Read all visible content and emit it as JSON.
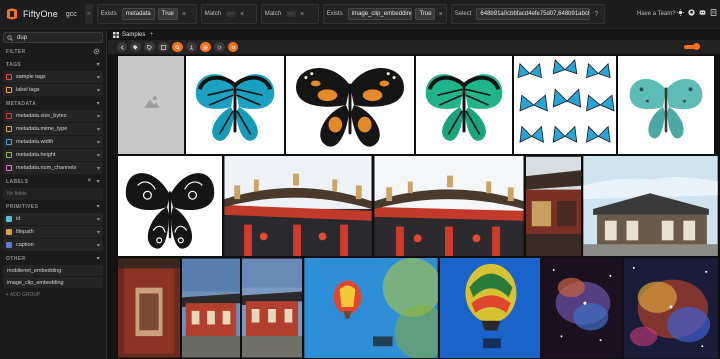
{
  "header": {
    "brand": "FiftyOne",
    "dataset": "gcc",
    "stages": [
      {
        "field": "metadata",
        "value": "True",
        "name": "Exists"
      },
      {
        "name": "Match"
      },
      {
        "name": "Match"
      },
      {
        "field": "image_clip_embedding",
        "value": "True",
        "name": "Exists"
      },
      {
        "name": "Select",
        "value": "648b91a0cbbfacd4efe75d07,648b91abcbbfacd4efe"
      }
    ],
    "team_link": "Have a Team?",
    "icons": [
      "sun-icon",
      "github-icon",
      "discord-icon",
      "docs-icon"
    ]
  },
  "sidebar": {
    "search_value": "dup",
    "filter_label": "FILTER",
    "sections": {
      "tags": "TAGS",
      "metadata": "METADATA",
      "labels": "LABELS",
      "primitives": "PRIMITIVES",
      "other": "OTHER"
    },
    "tags": [
      {
        "label": "sample tags",
        "color": "#e04c4c"
      },
      {
        "label": "label tags",
        "color": "#f39a3c"
      }
    ],
    "metadata": [
      {
        "label": "metadata.size_bytes",
        "color": "#d13a3a"
      },
      {
        "label": "metadata.mime_type",
        "color": "#e0a15a"
      },
      {
        "label": "metadata.width",
        "color": "#4f9bd8"
      },
      {
        "label": "metadata.height",
        "color": "#8fb940"
      },
      {
        "label": "metadata.num_channels",
        "color": "#e07ac0"
      }
    ],
    "no_fields": "No fields",
    "primitives": [
      {
        "label": "id",
        "color": "#54c2d6"
      },
      {
        "label": "filepath",
        "color": "#d9a046"
      },
      {
        "label": "caption",
        "color": "#5b7bd4"
      }
    ],
    "other": [
      {
        "label": "mobilenet_embedding"
      },
      {
        "label": "image_clip_embedding"
      }
    ],
    "add_group": "+ ADD GROUP"
  },
  "main": {
    "tab_label": "Samples",
    "tab_add": "+"
  },
  "colors": {
    "accent": "#f37021",
    "sidebar_bg": "#1b1b1b",
    "header_bg": "#1d1d1d"
  }
}
